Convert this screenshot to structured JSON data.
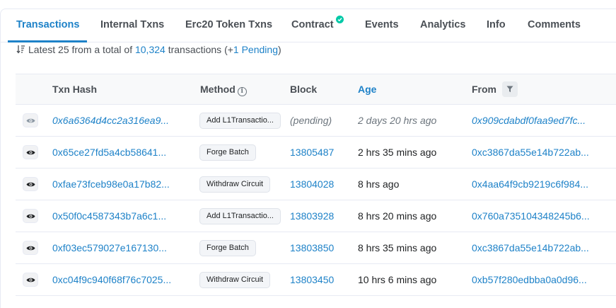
{
  "tabs": [
    {
      "label": "Transactions",
      "active": true
    },
    {
      "label": "Internal Txns"
    },
    {
      "label": "Erc20 Token Txns"
    },
    {
      "label": "Contract",
      "verified": true
    },
    {
      "label": "Events"
    },
    {
      "label": "Analytics"
    },
    {
      "label": "Info"
    },
    {
      "label": "Comments"
    }
  ],
  "summary": {
    "prefix": "Latest 25 from a total of ",
    "total": "10,324",
    "middle": " transactions (+",
    "pending": "1 Pending",
    "suffix": ")"
  },
  "table": {
    "headers": {
      "txn_hash": "Txn Hash",
      "method": "Method",
      "block": "Block",
      "age": "Age",
      "from": "From"
    },
    "rows": [
      {
        "hash": "0x6a6364d4cc2a316ea9...",
        "method": "Add L1Transactio...",
        "block": "(pending)",
        "age": "2 days 20 hrs ago",
        "from": "0x909cdabdf0faa9ed7fc...",
        "pending": true
      },
      {
        "hash": "0x65ce27fd5a4cb58641...",
        "method": "Forge Batch",
        "block": "13805487",
        "age": "2 hrs 35 mins ago",
        "from": "0xc3867da55e14b722ab..."
      },
      {
        "hash": "0xfae73fceb98e0a17b82...",
        "method": "Withdraw Circuit",
        "block": "13804028",
        "age": "8 hrs ago",
        "from": "0x4aa64f9cb9219c6f984..."
      },
      {
        "hash": "0x50f0c4587343b7a6c1...",
        "method": "Add L1Transactio...",
        "block": "13803928",
        "age": "8 hrs 20 mins ago",
        "from": "0x760a735104348245b6..."
      },
      {
        "hash": "0xf03ec579027e167130...",
        "method": "Forge Batch",
        "block": "13803850",
        "age": "8 hrs 35 mins ago",
        "from": "0xc3867da55e14b722ab..."
      },
      {
        "hash": "0xc04f9c940f68f76c7025...",
        "method": "Withdraw Circuit",
        "block": "13803450",
        "age": "10 hrs 6 mins ago",
        "from": "0xb57f280edbba0a0d96..."
      }
    ]
  },
  "colors": {
    "link": "#1e82c8",
    "verified": "#00c9a7"
  },
  "icons": {
    "sort": "sort-desc-icon",
    "info": "info-icon",
    "filter": "filter-icon",
    "eye": "eye-icon",
    "verified": "check-circle-icon"
  }
}
